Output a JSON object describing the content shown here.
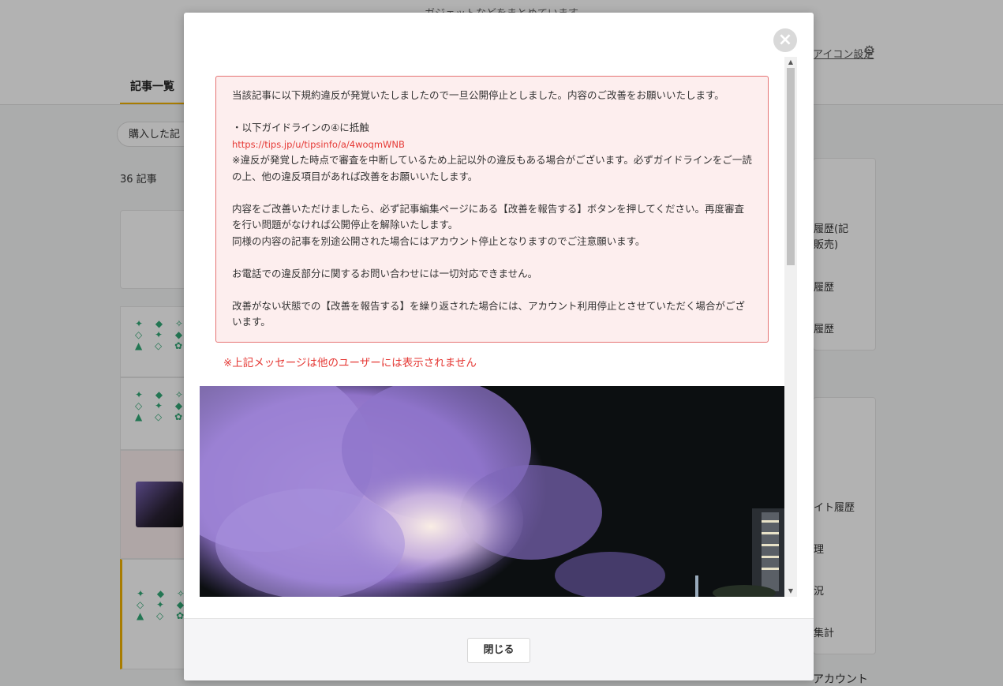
{
  "background": {
    "tagline": "ガジェットなどをまとめています",
    "icon_settings_label": "アイコン設定",
    "active_tab": "記事一覧",
    "filter_label": "購入した記",
    "article_count": "36 記事",
    "sidebar_items_1": [
      "履歴(記",
      "販売)",
      "履歴",
      "履歴"
    ],
    "sidebar_items_2": [
      "イト履歴",
      "理",
      "況",
      "集計"
    ],
    "sidebar_footer_label": "アカウント"
  },
  "modal": {
    "close_icon_glyph": "×",
    "notice": {
      "line1": "当該記事に以下規約違反が発覚いたしましたので一旦公開停止としました。内容のご改善をお願いいたします。",
      "line2": "・以下ガイドラインの④に抵触",
      "link": "https://tips.jp/u/tipsinfo/a/4woqmWNB",
      "line3": "※違反が発覚した時点で審査を中断しているため上記以外の違反もある場合がございます。必ずガイドラインをご一読の上、他の違反項目があれば改善をお願いいたします。",
      "line4": "内容をご改善いただけましたら、必ず記事編集ページにある【改善を報告する】ボタンを押してください。再度審査を行い問題がなければ公開停止を解除いたします。",
      "line5": "同様の内容の記事を別途公開された場合にはアカウント停止となりますのでご注意願います。",
      "line6": "お電話での違反部分に関するお問い合わせには一切対応できません。",
      "line7": "改善がない状態での【改善を報告する】を繰り返された場合には、アカウント利用停止とさせていただく場合がございます。"
    },
    "hidden_note": "※上記メッセージは他のユーザーには表示されません",
    "close_button_label": "閉じる"
  }
}
